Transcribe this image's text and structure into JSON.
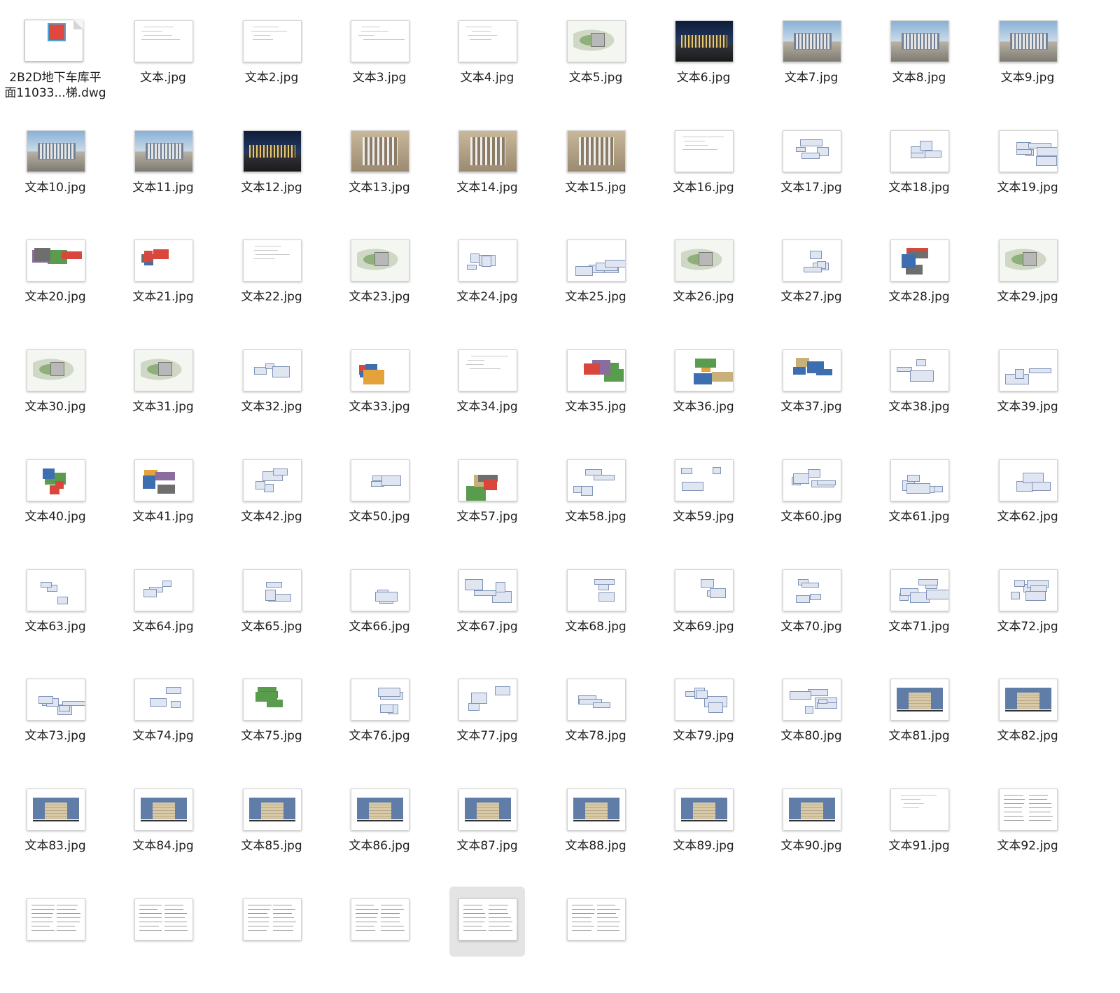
{
  "files": [
    {
      "name": "2B2D地下车库平\n面11033...梯.dwg",
      "icon": "dwg-file-icon",
      "kind": "dwg"
    },
    {
      "name": "文本.jpg",
      "kind": "blank"
    },
    {
      "name": "文本2.jpg",
      "kind": "blank"
    },
    {
      "name": "文本3.jpg",
      "kind": "blank"
    },
    {
      "name": "文本4.jpg",
      "kind": "blank"
    },
    {
      "name": "文本5.jpg",
      "kind": "site"
    },
    {
      "name": "文本6.jpg",
      "kind": "night"
    },
    {
      "name": "文本7.jpg",
      "kind": "photo"
    },
    {
      "name": "文本8.jpg",
      "kind": "photo"
    },
    {
      "name": "文本9.jpg",
      "kind": "photo"
    },
    {
      "name": "文本10.jpg",
      "kind": "photo"
    },
    {
      "name": "文本11.jpg",
      "kind": "photo"
    },
    {
      "name": "文本12.jpg",
      "kind": "night"
    },
    {
      "name": "文本13.jpg",
      "kind": "interior"
    },
    {
      "name": "文本14.jpg",
      "kind": "interior"
    },
    {
      "name": "文本15.jpg",
      "kind": "interior"
    },
    {
      "name": "文本16.jpg",
      "kind": "blank"
    },
    {
      "name": "文本17.jpg",
      "kind": "plan"
    },
    {
      "name": "文本18.jpg",
      "kind": "plan"
    },
    {
      "name": "文本19.jpg",
      "kind": "plan"
    },
    {
      "name": "文本20.jpg",
      "kind": "color"
    },
    {
      "name": "文本21.jpg",
      "kind": "color"
    },
    {
      "name": "文本22.jpg",
      "kind": "blank"
    },
    {
      "name": "文本23.jpg",
      "kind": "site"
    },
    {
      "name": "文本24.jpg",
      "kind": "plan"
    },
    {
      "name": "文本25.jpg",
      "kind": "plan"
    },
    {
      "name": "文本26.jpg",
      "kind": "site"
    },
    {
      "name": "文本27.jpg",
      "kind": "plan"
    },
    {
      "name": "文本28.jpg",
      "kind": "color"
    },
    {
      "name": "文本29.jpg",
      "kind": "site"
    },
    {
      "name": "文本30.jpg",
      "kind": "site"
    },
    {
      "name": "文本31.jpg",
      "kind": "site"
    },
    {
      "name": "文本32.jpg",
      "kind": "plan"
    },
    {
      "name": "文本33.jpg",
      "kind": "color"
    },
    {
      "name": "文本34.jpg",
      "kind": "blank"
    },
    {
      "name": "文本35.jpg",
      "kind": "color"
    },
    {
      "name": "文本36.jpg",
      "kind": "color"
    },
    {
      "name": "文本37.jpg",
      "kind": "color"
    },
    {
      "name": "文本38.jpg",
      "kind": "plan"
    },
    {
      "name": "文本39.jpg",
      "kind": "plan"
    },
    {
      "name": "文本40.jpg",
      "kind": "color"
    },
    {
      "name": "文本41.jpg",
      "kind": "color"
    },
    {
      "name": "文本42.jpg",
      "kind": "plan"
    },
    {
      "name": "文本50.jpg",
      "kind": "plan"
    },
    {
      "name": "文本57.jpg",
      "kind": "color"
    },
    {
      "name": "文本58.jpg",
      "kind": "plan"
    },
    {
      "name": "文本59.jpg",
      "kind": "plan"
    },
    {
      "name": "文本60.jpg",
      "kind": "plan"
    },
    {
      "name": "文本61.jpg",
      "kind": "plan"
    },
    {
      "name": "文本62.jpg",
      "kind": "plan"
    },
    {
      "name": "文本63.jpg",
      "kind": "plan"
    },
    {
      "name": "文本64.jpg",
      "kind": "plan"
    },
    {
      "name": "文本65.jpg",
      "kind": "plan"
    },
    {
      "name": "文本66.jpg",
      "kind": "plan"
    },
    {
      "name": "文本67.jpg",
      "kind": "plan"
    },
    {
      "name": "文本68.jpg",
      "kind": "plan"
    },
    {
      "name": "文本69.jpg",
      "kind": "plan"
    },
    {
      "name": "文本70.jpg",
      "kind": "plan"
    },
    {
      "name": "文本71.jpg",
      "kind": "plan"
    },
    {
      "name": "文本72.jpg",
      "kind": "plan"
    },
    {
      "name": "文本73.jpg",
      "kind": "plan"
    },
    {
      "name": "文本74.jpg",
      "kind": "plan"
    },
    {
      "name": "文本75.jpg",
      "kind": "color"
    },
    {
      "name": "文本76.jpg",
      "kind": "plan"
    },
    {
      "name": "文本77.jpg",
      "kind": "plan"
    },
    {
      "name": "文本78.jpg",
      "kind": "plan"
    },
    {
      "name": "文本79.jpg",
      "kind": "plan"
    },
    {
      "name": "文本80.jpg",
      "kind": "plan"
    },
    {
      "name": "文本81.jpg",
      "kind": "elev"
    },
    {
      "name": "文本82.jpg",
      "kind": "elev"
    },
    {
      "name": "文本83.jpg",
      "kind": "elev"
    },
    {
      "name": "文本84.jpg",
      "kind": "elev"
    },
    {
      "name": "文本85.jpg",
      "kind": "elev"
    },
    {
      "name": "文本86.jpg",
      "kind": "elev"
    },
    {
      "name": "文本87.jpg",
      "kind": "elev"
    },
    {
      "name": "文本88.jpg",
      "kind": "elev"
    },
    {
      "name": "文本89.jpg",
      "kind": "elev"
    },
    {
      "name": "文本90.jpg",
      "kind": "elev"
    },
    {
      "name": "文本91.jpg",
      "kind": "blank"
    },
    {
      "name": "文本92.jpg",
      "kind": "text"
    },
    {
      "name": "",
      "kind": "text"
    },
    {
      "name": "",
      "kind": "text"
    },
    {
      "name": "",
      "kind": "text"
    },
    {
      "name": "",
      "kind": "text"
    },
    {
      "name": "",
      "kind": "text",
      "selected": true
    },
    {
      "name": "",
      "kind": "text"
    }
  ],
  "colors": {
    "selection_bg": "#e4e4e4",
    "label": "#1d1d1d"
  }
}
